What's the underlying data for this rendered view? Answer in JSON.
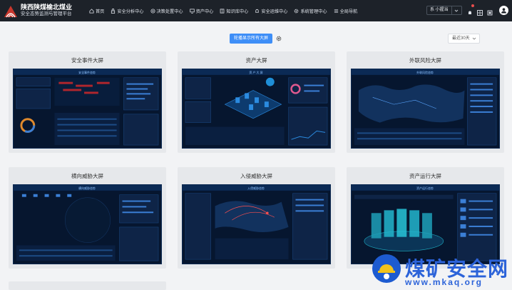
{
  "header": {
    "title": "陕西陕煤榆北煤业",
    "subtitle": "安全态势监测与管理平台",
    "nav": [
      {
        "label": "首页",
        "icon": "home-icon"
      },
      {
        "label": "安全分析中心",
        "icon": "lock-icon"
      },
      {
        "label": "决策处置中心",
        "icon": "target-icon"
      },
      {
        "label": "资产中心",
        "icon": "monitor-icon"
      },
      {
        "label": "知识库中心",
        "icon": "book-icon"
      },
      {
        "label": "安全运维中心",
        "icon": "bell-icon"
      },
      {
        "label": "系统管理中心",
        "icon": "gear-icon"
      },
      {
        "label": "全局导航",
        "icon": "menu-icon"
      }
    ],
    "user": {
      "label": "系 小握当"
    }
  },
  "toolbar": {
    "carousel_label": "轮播显示所有大屏",
    "range_value": "最近30天"
  },
  "cards": [
    {
      "title": "安全事件大屏",
      "thumb_header": "安全事件态势"
    },
    {
      "title": "资产大屏",
      "thumb_header": "资 产 大 屏"
    },
    {
      "title": "外联风险大屏",
      "thumb_header": "外联风险态势"
    },
    {
      "title": "横向威胁大屏",
      "thumb_header": "横向威胁态势"
    },
    {
      "title": "入侵威胁大屏",
      "thumb_header": "入侵威胁态势"
    },
    {
      "title": "资产运行大屏",
      "thumb_header": "资产运行态势"
    }
  ],
  "colors": {
    "topbar": "#1d2229",
    "accent": "#3e8ef7",
    "thumb_bg": "#06162f"
  },
  "watermark": {
    "text": "煤矿安全网",
    "url": "www.mkaq.org"
  }
}
